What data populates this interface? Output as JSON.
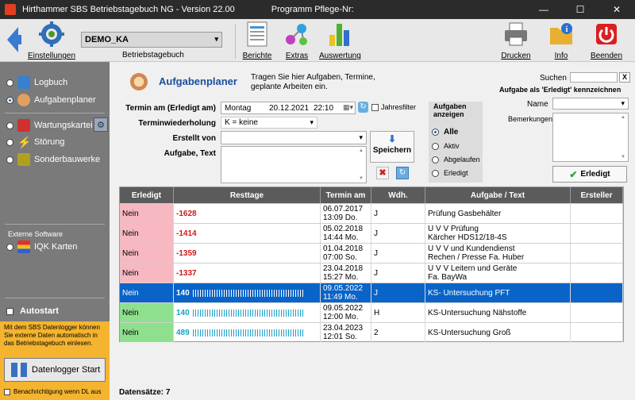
{
  "window": {
    "title": "Hirthammer SBS Betriebstagebuch NG - Version 22.00",
    "program": "Programm Pflege-Nr:",
    "minimize": "—",
    "maximize": "☐",
    "close": "✕"
  },
  "toolbar": {
    "settings_label": "Einstellungen",
    "diary_value": "DEMO_KA",
    "diary_caption": "Betriebstagebuch",
    "reports_label": "Berichte",
    "extras_label": "Extras",
    "evaluation_label": "Auswertung",
    "print_label": "Drucken",
    "info_label": "Info",
    "exit_label": "Beenden"
  },
  "sidebar": {
    "logbook": "Logbuch",
    "planner": "Aufgabenplaner",
    "maintenance": "Wartungskartei",
    "fault": "Störung",
    "special": "Sonderbauwerke",
    "external_heading": "Externe Software",
    "iqk": "IQK Karten",
    "autostart": "Autostart",
    "logger_info": "Mit dem SBS Datenlogger können Sie externe Daten automatisch in das Betriebstagebuch einlesen.",
    "logger_button": "Datenlogger Start",
    "notify": "Benachrichtigung wenn DL aus"
  },
  "planner": {
    "title": "Aufgabenplaner",
    "description": "Tragen Sie hier Aufgaben, Termine, geplante Arbeiten ein.",
    "due_label": "Termin am (Erledigt am)",
    "due_day": "Montag",
    "due_date": "20.12.2021",
    "due_time": "22:10",
    "year_filter": "Jahresfilter",
    "repeat_label": "Terminwiederholung",
    "repeat_value": "K = keine",
    "creator_label": "Erstellt von",
    "task_label": "Aufgabe, Text",
    "save_button": "Speichern",
    "show_label": "Aufgaben anzeigen",
    "show_options": [
      "Alle",
      "Aktiv",
      "Abgelaufen",
      "Erledigt"
    ],
    "search_label": "Suchen",
    "search_clear": "X",
    "done_heading": "Aufgabe als 'Erledigt' kennzeichnen",
    "name_label": "Name",
    "remarks_label": "Bemerkungen",
    "done_button": "Erledigt"
  },
  "grid": {
    "headers": [
      "Erledigt",
      "Resttage",
      "Termin am",
      "Wdh.",
      "Aufgabe / Text",
      "Ersteller"
    ],
    "rows": [
      {
        "done": "Nein",
        "rest": "-1628",
        "date": "06.07.2017",
        "time": "13:09 Do.",
        "rep": "J",
        "task1": "Prüfung Gasbehälter",
        "task2": "",
        "status": "overdue"
      },
      {
        "done": "Nein",
        "rest": "-1414",
        "date": "05.02.2018",
        "time": "14:44 Mo.",
        "rep": "J",
        "task1": "U V V Prüfung",
        "task2": "Kärcher HDS12/18-4S",
        "status": "overdue"
      },
      {
        "done": "Nein",
        "rest": "-1359",
        "date": "01.04.2018",
        "time": "07:00 So.",
        "rep": "J",
        "task1": "U V V und Kundendienst",
        "task2": "Rechen / Presse  Fa. Huber",
        "status": "overdue"
      },
      {
        "done": "Nein",
        "rest": "-1337",
        "date": "23.04.2018",
        "time": "15:27 Mo.",
        "rep": "J",
        "task1": "U V V Leitern und Geräte",
        "task2": "Fa. BayWa",
        "status": "overdue"
      },
      {
        "done": "Nein",
        "rest": "140",
        "date": "09.05.2022",
        "time": "11:49 Mo.",
        "rep": "J",
        "task1": "KS- Untersuchung PFT",
        "task2": "",
        "status": "selected"
      },
      {
        "done": "Nein",
        "rest": "140",
        "date": "09.05.2022",
        "time": "12:00 Mo.",
        "rep": "H",
        "task1": "KS-Untersuchung Nähstoffe",
        "task2": "",
        "status": "ok"
      },
      {
        "done": "Nein",
        "rest": "489",
        "date": "23.04.2023",
        "time": "12:01 So.",
        "rep": "2",
        "task1": "KS-Untersuchung Groß",
        "task2": "",
        "status": "ok"
      }
    ],
    "count_label": "Datensätze: 7"
  },
  "colors": {
    "overdue_bg": "#f7b8c2",
    "ok_bg": "#8ee08e",
    "selected_bg": "#0a64c8",
    "overdue_text": "#d01818",
    "ok_text": "#1aa0c8"
  }
}
